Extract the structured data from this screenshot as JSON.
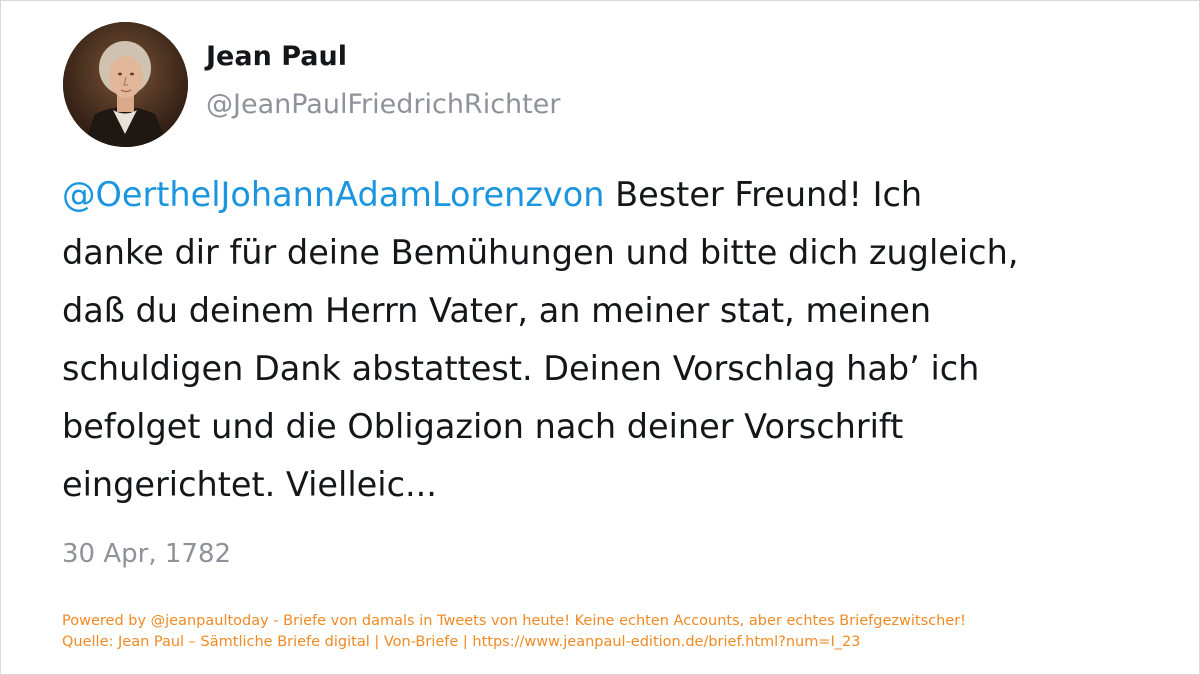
{
  "author": {
    "avatar_icon": "portrait-avatar",
    "display_name": "Jean Paul",
    "handle": "@JeanPaulFriedrichRichter"
  },
  "tweet": {
    "mention": "@OerthelJohannAdamLorenzvon",
    "lines": [
      " Bester Freund! Ich",
      "danke dir für deine Bemühungen und bitte dich zugleich,",
      "daß du deinem Herrn Vater, an meiner stat, meinen",
      "schuldigen Dank abstattest. Deinen Vorschlag hab’ ich",
      "befolget und die Obligazion nach deiner Vorschrift",
      "eingerichtet. Vielleic..."
    ],
    "date": "30 Apr, 1782"
  },
  "footer": {
    "powered_by": "Powered by @jeanpaultoday - Briefe von damals in Tweets von heute! Keine echten Accounts, aber echtes Briefgezwitscher!",
    "source": "Quelle: Jean Paul – Sämtliche Briefe digital | Von-Briefe | https://www.jeanpaul-edition.de/brief.html?num=I_23"
  },
  "colors": {
    "mention": "#1b95e0",
    "text": "#14171a",
    "muted": "#8e9399",
    "footer": "#f08a24"
  }
}
